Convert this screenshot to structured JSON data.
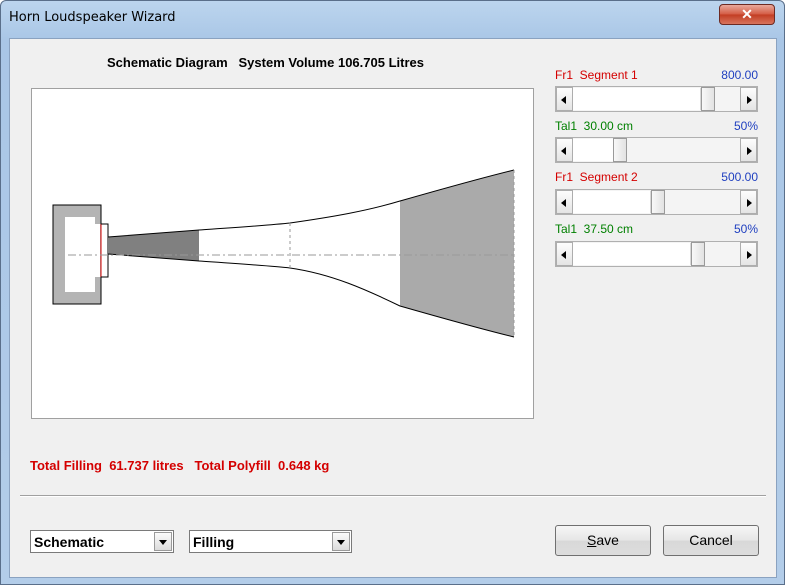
{
  "window": {
    "title": "Horn Loudspeaker Wizard",
    "close_label": "✕"
  },
  "diagram": {
    "title": "Schematic Diagram   System Volume 106.705 Litres"
  },
  "sliders": [
    {
      "label": "Fr1  Segment 1",
      "value": "800.00",
      "label_color": "#d40000",
      "position": 0.86
    },
    {
      "label": "Tal1  30.00 cm",
      "value": "50%",
      "label_color": "#008000",
      "position": 0.3
    },
    {
      "label": "Fr1  Segment 2",
      "value": "500.00",
      "label_color": "#d40000",
      "position": 0.5
    },
    {
      "label": "Tal1  37.50 cm",
      "value": "50%",
      "label_color": "#008000",
      "position": 0.82
    }
  ],
  "totals": {
    "text": "Total Filling  61.737 litres   Total Polyfill  0.648 kg"
  },
  "view_select": {
    "value": "Schematic"
  },
  "mode_select": {
    "value": "Filling"
  },
  "buttons": {
    "save": "Save",
    "save_hotkey": "S",
    "save_rest": "ave",
    "cancel": "Cancel"
  },
  "colors": {
    "label_red": "#d40000",
    "label_green": "#008000",
    "value_blue": "#2040c0",
    "fill_grey": "#aaaaaa"
  }
}
